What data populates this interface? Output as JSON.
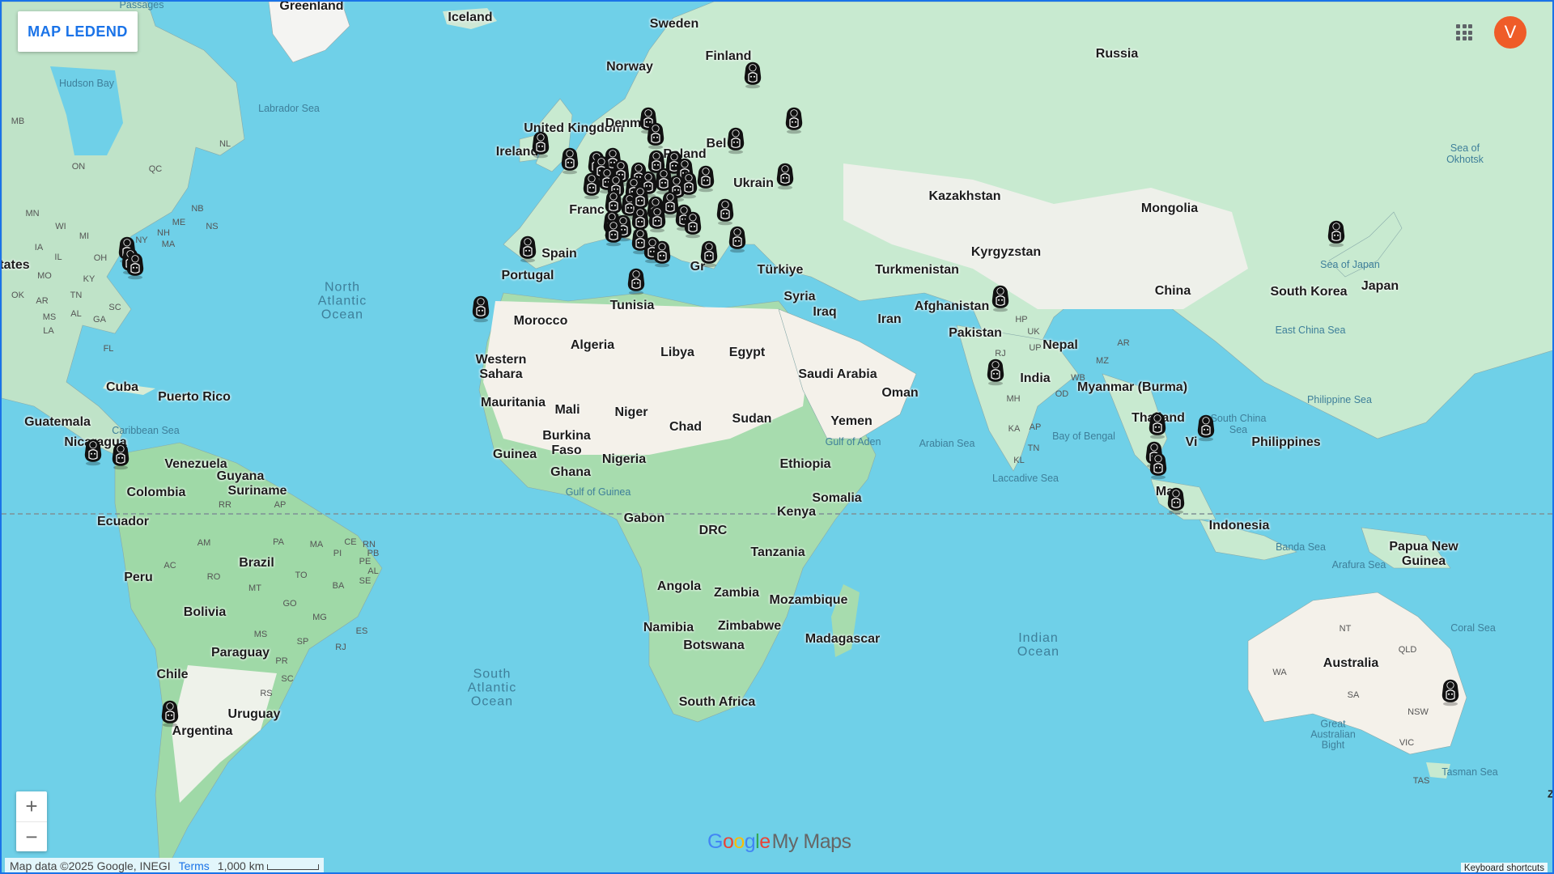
{
  "legend_button_label": "MAP LEDEND",
  "user_initial": "V",
  "attribution": {
    "map_data": "Map data ©2025 Google, INEGI",
    "terms": "Terms",
    "scale": "1,000 km"
  },
  "keyboard_shortcuts": "Keyboard shortcuts",
  "brand": {
    "google": "Google",
    "product": "My Maps"
  },
  "labels": {
    "greenland": "Greenland",
    "iceland": "Iceland",
    "sweden": "Sweden",
    "finland": "Finland",
    "norway": "Norway",
    "russia": "Russia",
    "hudson_bay": "Hudson Bay",
    "labrador_sea": "Labrador Sea",
    "uk": "United Kingdom",
    "ireland": "Ireland",
    "denmark": "Denm",
    "belarus": "Bel",
    "poland": "Poland",
    "ukraine": "Ukrain",
    "france": "Franc",
    "spain": "Spain",
    "portugal": "Portugal",
    "turkiye": "Türkiye",
    "greece": "Gr",
    "tunisia": "Tunisia",
    "morocco": "Morocco",
    "algeria": "Algeria",
    "libya": "Libya",
    "egypt": "Egypt",
    "kazakhstan": "Kazakhstan",
    "mongolia": "Mongolia",
    "kyrgyzstan": "Kyrgyzstan",
    "turkmenistan": "Turkmenistan",
    "syria": "Syria",
    "iraq": "Iraq",
    "iran": "Iran",
    "afghanistan": "Afghanistan",
    "pakistan": "Pakistan",
    "china": "China",
    "south_korea": "South Korea",
    "japan": "Japan",
    "nepal": "Nepal",
    "india": "India",
    "myanmar": "Myanmar (Burma)",
    "thailand": "Thailand",
    "vietnam": "Vi",
    "philippines": "Philippines",
    "malaysia": "Ma",
    "indonesia": "Indonesia",
    "png": "Papua New Guinea",
    "australia": "Australia",
    "western_sahara": "Western Sahara",
    "mauritania": "Mauritania",
    "mali": "Mali",
    "niger": "Niger",
    "chad": "Chad",
    "sudan": "Sudan",
    "saudi_arabia": "Saudi Arabia",
    "oman": "Oman",
    "yemen": "Yemen",
    "ethiopia": "Ethiopia",
    "somalia": "Somalia",
    "kenya": "Kenya",
    "tanzania": "Tanzania",
    "drc": "DRC",
    "gabon": "Gabon",
    "angola": "Angola",
    "zambia": "Zambia",
    "mozambique": "Mozambique",
    "madagascar": "Madagascar",
    "namibia": "Namibia",
    "zimbabwe": "Zimbabwe",
    "botswana": "Botswana",
    "south_africa": "South Africa",
    "nigeria": "Nigeria",
    "ghana": "Ghana",
    "guinea": "Guinea",
    "burkina": "Burkina Faso",
    "cuba": "Cuba",
    "puerto_rico": "Puerto Rico",
    "guatemala": "Guatemala",
    "nicaragua": "Nicaragua",
    "venezuela": "Venezuela",
    "colombia": "Colombia",
    "guyana": "Guyana",
    "suriname": "Suriname",
    "ecuador": "Ecuador",
    "peru": "Peru",
    "brazil": "Brazil",
    "bolivia": "Bolivia",
    "paraguay": "Paraguay",
    "chile": "Chile",
    "uruguay": "Uruguay",
    "argentina": "Argentina",
    "states": "tates",
    "north_atlantic": "North Atlantic Ocean",
    "south_atlantic": "South Atlantic Ocean",
    "indian_ocean": "Indian Ocean",
    "caribbean_sea": "Caribbean Sea",
    "gulf_of_guinea": "Gulf of Guinea",
    "gulf_of_aden": "Gulf of Aden",
    "arabian_sea": "Arabian Sea",
    "bay_of_bengal": "Bay of Bengal",
    "laccadive_sea": "Laccadive Sea",
    "south_china_sea": "South China Sea",
    "philippine_sea": "Philippine Sea",
    "east_china_sea": "East China Sea",
    "sea_of_japan": "Sea of Japan",
    "sea_of_okhotsk": "Sea of Okhotsk",
    "banda_sea": "Banda Sea",
    "arafura_sea": "Arafura Sea",
    "coral_sea": "Coral Sea",
    "tasman_sea": "Tasman Sea",
    "great_australian_bight": "Great Australian Bight",
    "passages": "Passages",
    "st_mb": "MB",
    "st_on": "ON",
    "st_qc": "QC",
    "st_nl": "NL",
    "st_nb": "NB",
    "st_me": "ME",
    "st_ns": "NS",
    "st_mn": "MN",
    "st_wi": "WI",
    "st_mi": "MI",
    "st_ny": "NY",
    "st_ia": "IA",
    "st_il": "IL",
    "st_oh": "OH",
    "st_mo": "MO",
    "st_ky": "KY",
    "st_ok": "OK",
    "st_ar": "AR",
    "st_tn": "TN",
    "st_sc": "SC",
    "st_ms": "MS",
    "st_al": "AL",
    "st_ga": "GA",
    "st_la": "LA",
    "st_fl": "FL",
    "st_ma": "MA",
    "st_nh": "NH",
    "st_am": "AM",
    "st_pa": "PA",
    "st_ma2": "MA",
    "st_ce": "CE",
    "st_rn": "RN",
    "st_pb": "PB",
    "st_pi": "PI",
    "st_pe": "PE",
    "st_ac": "AC",
    "st_ro": "RO",
    "st_to": "TO",
    "st_al2": "AL",
    "st_se": "SE",
    "st_ba": "BA",
    "st_mt": "MT",
    "st_go": "GO",
    "st_ms2": "MS",
    "st_mg": "MG",
    "st_es": "ES",
    "st_sp": "SP",
    "st_rj": "RJ",
    "st_pr": "PR",
    "st_sc2": "SC",
    "st_rs": "RS",
    "st_rr": "RR",
    "st_ap": "AP",
    "st_hp": "HP",
    "st_uk": "UK",
    "st_up": "UP",
    "st_rj2": "RJ",
    "st_mh": "MH",
    "st_ka": "KA",
    "st_kl": "KL",
    "st_tn2": "TN",
    "st_ap2": "AP",
    "st_wb": "WB",
    "st_ar2": "AR",
    "st_mz": "MZ",
    "st_od": "OD",
    "st_nt": "NT",
    "st_qld": "QLD",
    "st_wa": "WA",
    "st_sa": "SA",
    "st_nsw": "NSW",
    "st_vic": "VIC",
    "st_tas": "TAS",
    "z": "Z"
  },
  "marker_count": 62
}
